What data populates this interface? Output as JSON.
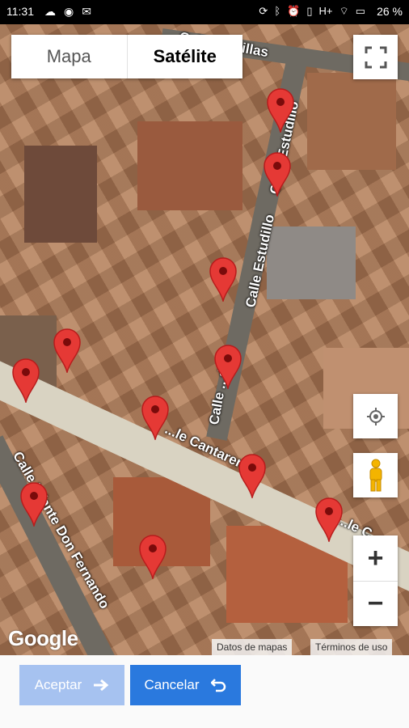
{
  "status_bar": {
    "time": "11:31",
    "battery": "26 %",
    "network": "H+"
  },
  "map_type": {
    "map_label": "Mapa",
    "satellite_label": "Satélite",
    "selected": "Satélite"
  },
  "streets": {
    "top": "Calle ...ecillas",
    "estudillo_1": "Calle Estudillo",
    "estudillo_2": "Calle Estudillo",
    "estudillo_3": "Calle ...dillo",
    "cantareros": "...le Cantareros",
    "cantareros_right": "...le C...",
    "infante": "Calle Infante Don Fernando"
  },
  "map_footer": {
    "logo": "Google",
    "map_data": "Datos de mapas",
    "terms": "Términos de uso"
  },
  "controls": {
    "zoom_in": "+",
    "zoom_out": "−"
  },
  "buttons": {
    "accept": "Aceptar",
    "cancel": "Cancelar"
  },
  "colors": {
    "pin": "#e53935",
    "accept_button": "#a6c2f0",
    "cancel_button": "#2a79de"
  },
  "pins_count": 11
}
